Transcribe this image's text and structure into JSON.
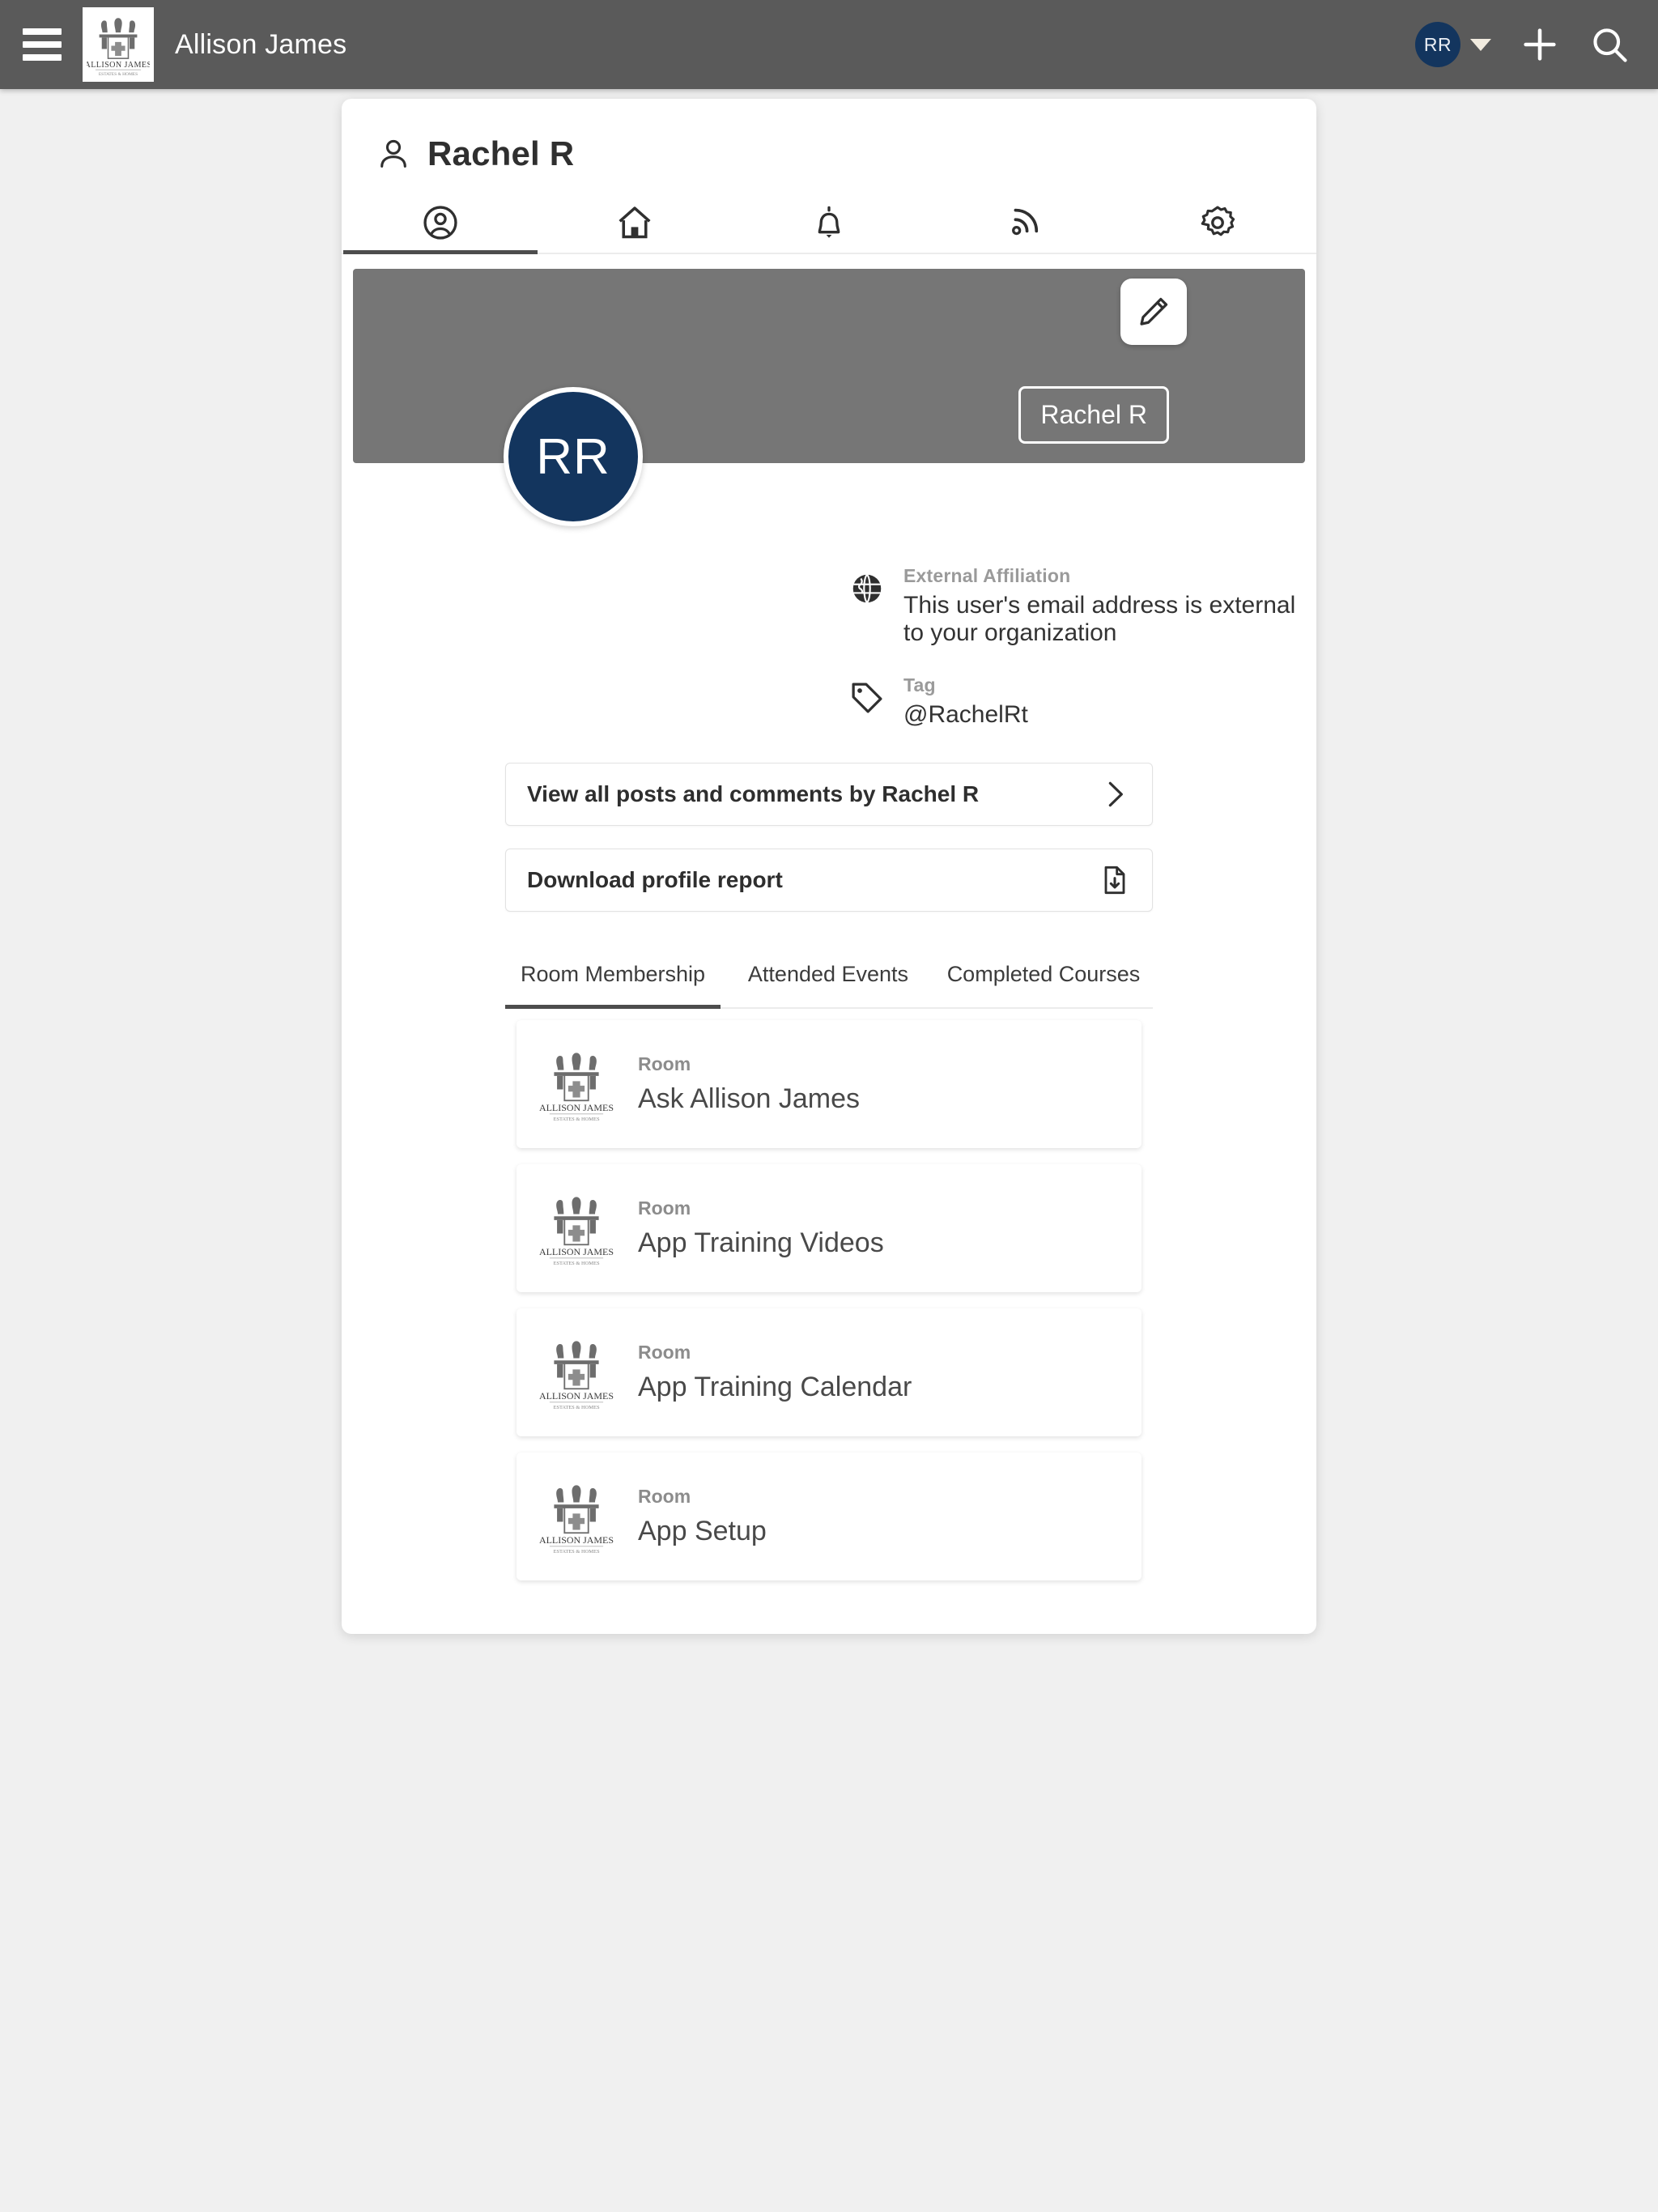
{
  "appbar": {
    "menu_icon": "hamburger-menu-icon",
    "brand": "Allison James",
    "logo_alt": "Allison James Estates & Homes crest logo",
    "user_initials": "RR",
    "caret_icon": "chevron-down-icon",
    "add_icon": "plus-icon",
    "search_icon": "search-icon"
  },
  "profile": {
    "page_title": "Rachel R",
    "title_icon": "person-icon",
    "tabs": [
      {
        "name": "profile",
        "icon": "user-circle-icon",
        "active": true
      },
      {
        "name": "home",
        "icon": "home-icon",
        "active": false
      },
      {
        "name": "notifications",
        "icon": "bell-icon",
        "active": false
      },
      {
        "name": "feed",
        "icon": "rss-feed-icon",
        "active": false
      },
      {
        "name": "settings",
        "icon": "gear-icon",
        "active": false
      }
    ],
    "banner": {
      "edit_icon": "pencil-edit-icon",
      "name_chip": "Rachel R",
      "avatar_initials": "RR"
    },
    "info": [
      {
        "icon": "globe-icon",
        "label": "External Affiliation",
        "value": "This user's email address is external to your organization"
      },
      {
        "icon": "tag-icon",
        "label": "Tag",
        "value": "@RachelRt"
      }
    ],
    "actions": [
      {
        "label": "View all posts and comments by Rachel R",
        "end_icon": "chevron-right-icon"
      },
      {
        "label": "Download profile report",
        "end_icon": "file-download-icon"
      }
    ],
    "subtabs": [
      {
        "label": "Room Membership",
        "active": true
      },
      {
        "label": "Attended Events",
        "active": false
      },
      {
        "label": "Completed Courses",
        "active": false
      }
    ],
    "rooms": [
      {
        "kind": "Room",
        "name": "Ask Allison James",
        "logo": "allison-james-crest-icon"
      },
      {
        "kind": "Room",
        "name": "App Training Videos",
        "logo": "allison-james-crest-icon"
      },
      {
        "kind": "Room",
        "name": "App Training Calendar",
        "logo": "allison-james-crest-icon"
      },
      {
        "kind": "Room",
        "name": "App Setup",
        "logo": "allison-james-crest-icon"
      }
    ]
  },
  "colors": {
    "appbar_bg": "#5a5a5a",
    "banner_bg": "#767676",
    "avatar_navy": "#13355e",
    "page_bg": "#f0f0f0",
    "accent_underline": "#4d4d4d"
  }
}
